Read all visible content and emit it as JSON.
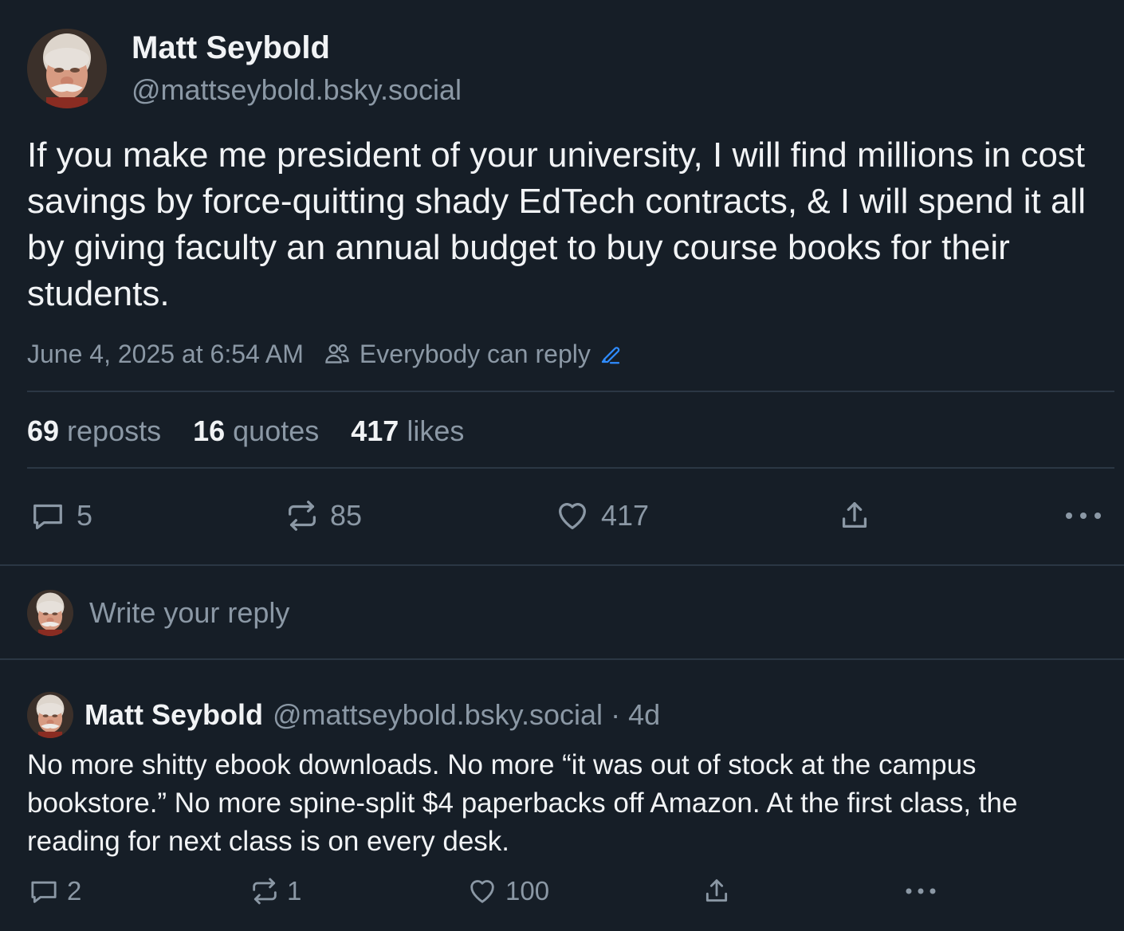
{
  "post": {
    "author_name": "Matt Seybold",
    "author_handle": "@mattseybold.bsky.social",
    "text": "If you make me president of your university, I will find millions in cost savings by force-quitting shady EdTech contracts, & I will spend it all by giving faculty an annual budget to buy course books for their students.",
    "timestamp": "June 4, 2025 at 6:54 AM",
    "reply_setting": "Everybody can reply",
    "reposts_count": "69",
    "reposts_label": "reposts",
    "quotes_count": "16",
    "quotes_label": "quotes",
    "likes_count": "417",
    "likes_label": "likes",
    "actions": {
      "reply_count": "5",
      "repost_count": "85",
      "like_count": "417"
    }
  },
  "composer": {
    "placeholder": "Write your reply"
  },
  "reply": {
    "author_name": "Matt Seybold",
    "author_handle": "@mattseybold.bsky.social",
    "separator": "·",
    "time_ago": "4d",
    "text": "No more shitty ebook downloads. No more “it was out of stock at the campus bookstore.” No more spine-split $4 paperbacks off Amazon. At the first class, the reading for next class is on every desk.",
    "actions": {
      "reply_count": "2",
      "repost_count": "1",
      "like_count": "100"
    }
  },
  "colors": {
    "background": "#161e27",
    "text_primary": "#f1f3f5",
    "text_secondary": "#8b98a5",
    "divider": "#2b3744",
    "accent": "#2f8cff"
  },
  "icons": [
    "avatar-puppet",
    "people-icon",
    "pencil-icon",
    "reply-bubble-icon",
    "repost-icon",
    "heart-icon",
    "share-icon",
    "more-dots-icon"
  ]
}
